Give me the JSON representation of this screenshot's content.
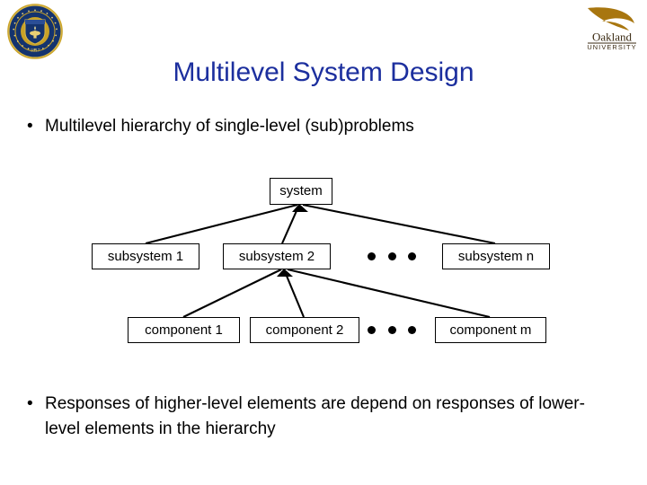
{
  "slide": {
    "title": "Multilevel System Design",
    "bullet_mark": "•",
    "bullets": [
      {
        "text": "Multilevel hierarchy of single-level (sub)problems"
      },
      {
        "text": "Responses of higher-level elements are depend on responses of lower-level elements in the hierarchy"
      }
    ],
    "title_color": "#1c2f9e",
    "text_color": "#000000",
    "background_color": "#ffffff"
  },
  "logos": {
    "left": {
      "name": "university-of-michigan-seal",
      "ring_text_top": "THE UNIVERSITY OF MICHIGAN",
      "year": "1817",
      "colors": {
        "gold": "#c9a227",
        "navy": "#14336e"
      }
    },
    "right": {
      "name": "oakland-university-logo",
      "wordmark": "Oakland",
      "subtitle": "UNIVERSITY",
      "colors": {
        "gold": "#a8760f",
        "text": "#3a2a12"
      }
    }
  },
  "diagram": {
    "type": "hierarchy-tree",
    "levels": [
      {
        "name": "system-level",
        "nodes": [
          {
            "id": "system",
            "label": "system"
          }
        ]
      },
      {
        "name": "subsystem-level",
        "nodes": [
          {
            "id": "subsystem-1",
            "label": "subsystem 1"
          },
          {
            "id": "subsystem-2",
            "label": "subsystem 2"
          },
          {
            "id": "subsystem-ellipsis",
            "label": "• • •"
          },
          {
            "id": "subsystem-n",
            "label": "subsystem n"
          }
        ]
      },
      {
        "name": "component-level",
        "nodes": [
          {
            "id": "component-1",
            "label": "component 1"
          },
          {
            "id": "component-2",
            "label": "component 2"
          },
          {
            "id": "component-ellipsis",
            "label": "• • •"
          },
          {
            "id": "component-m",
            "label": "component m"
          }
        ]
      }
    ],
    "edges": [
      {
        "from": "subsystem-1",
        "to": "system"
      },
      {
        "from": "subsystem-2",
        "to": "system"
      },
      {
        "from": "subsystem-n",
        "to": "system"
      },
      {
        "from": "component-1",
        "to": "subsystem-2"
      },
      {
        "from": "component-2",
        "to": "subsystem-2"
      },
      {
        "from": "component-m",
        "to": "subsystem-2"
      }
    ],
    "line_color": "#000000",
    "box_border_color": "#000000"
  }
}
